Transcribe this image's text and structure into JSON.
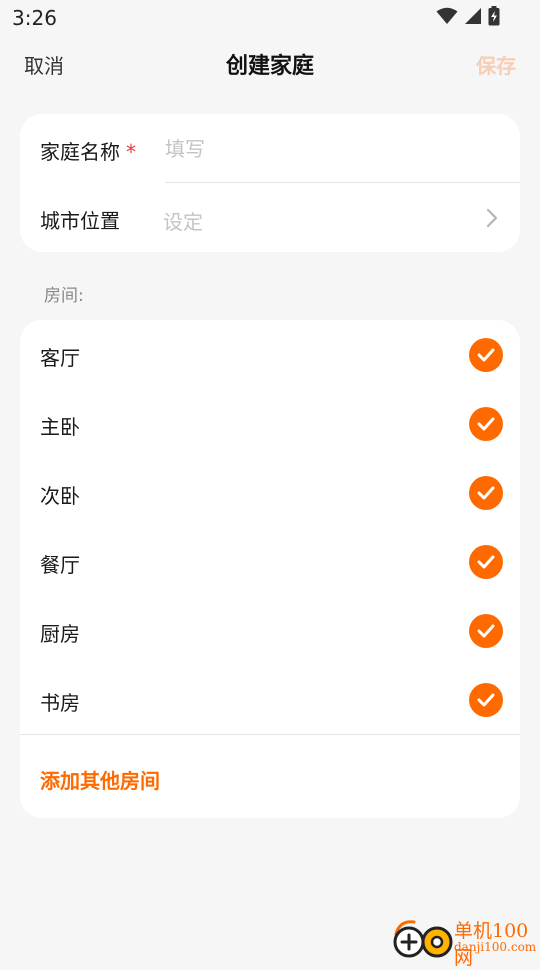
{
  "status_bar": {
    "time": "3:26",
    "icons": [
      "wifi-icon",
      "signal-icon",
      "battery-charging-icon"
    ]
  },
  "header": {
    "cancel_label": "取消",
    "title": "创建家庭",
    "save_label": "保存"
  },
  "family_info": {
    "name_label": "家庭名称",
    "required_mark": "*",
    "name_placeholder": "填写",
    "name_value": "",
    "city_label": "城市位置",
    "city_placeholder": "设定"
  },
  "rooms_section": {
    "label": "房间:",
    "rooms": [
      {
        "name": "客厅",
        "checked": true
      },
      {
        "name": "主卧",
        "checked": true
      },
      {
        "name": "次卧",
        "checked": true
      },
      {
        "name": "餐厅",
        "checked": true
      },
      {
        "name": "厨房",
        "checked": true
      },
      {
        "name": "书房",
        "checked": true
      }
    ],
    "add_room_label": "添加其他房间"
  },
  "watermark": {
    "title": "单机100网",
    "url": "danji100.com"
  },
  "colors": {
    "accent": "#ff6a00",
    "save_disabled": "#f8cdb6",
    "required": "#e53935",
    "placeholder": "#c4c4c4",
    "background": "#f6f6f6",
    "card": "#ffffff"
  }
}
